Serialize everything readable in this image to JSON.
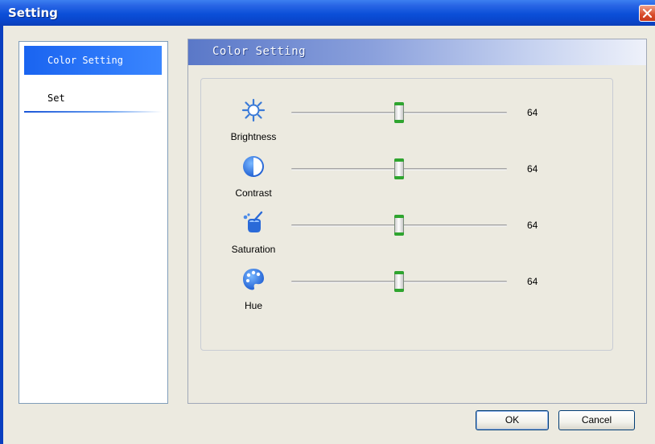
{
  "window": {
    "title": "Setting"
  },
  "sidebar": {
    "items": [
      {
        "label": "Color Setting",
        "selected": true
      },
      {
        "label": "Set",
        "selected": false
      }
    ]
  },
  "main": {
    "header_title": "Color Setting",
    "sliders": [
      {
        "label": "Brightness",
        "value": "64",
        "fraction": 0.5,
        "icon": "brightness-icon"
      },
      {
        "label": "Contrast",
        "value": "64",
        "fraction": 0.5,
        "icon": "contrast-icon"
      },
      {
        "label": "Saturation",
        "value": "64",
        "fraction": 0.5,
        "icon": "saturation-icon"
      },
      {
        "label": "Hue",
        "value": "64",
        "fraction": 0.5,
        "icon": "hue-icon"
      }
    ]
  },
  "buttons": {
    "ok": "OK",
    "cancel": "Cancel"
  },
  "colors": {
    "title_bar": "#0b4fd8",
    "selection": "#1a64f0",
    "slider_accent": "#2fa52f",
    "close_button": "#d84a2a"
  }
}
